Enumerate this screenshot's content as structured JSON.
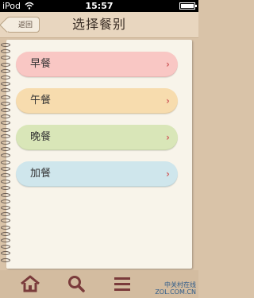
{
  "statusbar": {
    "carrier": "iPod",
    "time": "15:57"
  },
  "header": {
    "back_label": "返回",
    "title": "选择餐别"
  },
  "menu": [
    {
      "label": "早餐",
      "color": "#f9c7c4"
    },
    {
      "label": "午餐",
      "color": "#f7dcae"
    },
    {
      "label": "晚餐",
      "color": "#d9e6b8"
    },
    {
      "label": "加餐",
      "color": "#cfe6ec"
    }
  ],
  "toolbar": {
    "home_icon": "home-icon",
    "search_icon": "search-icon",
    "menu_icon": "menu-icon"
  },
  "watermark": {
    "line1": "中关村在线",
    "line2": "ZOL.COM.CN"
  },
  "colors": {
    "accent_chevron": "#d06060",
    "toolbar_bg": "#d3bca0",
    "icon_color": "#7a3b3b"
  }
}
